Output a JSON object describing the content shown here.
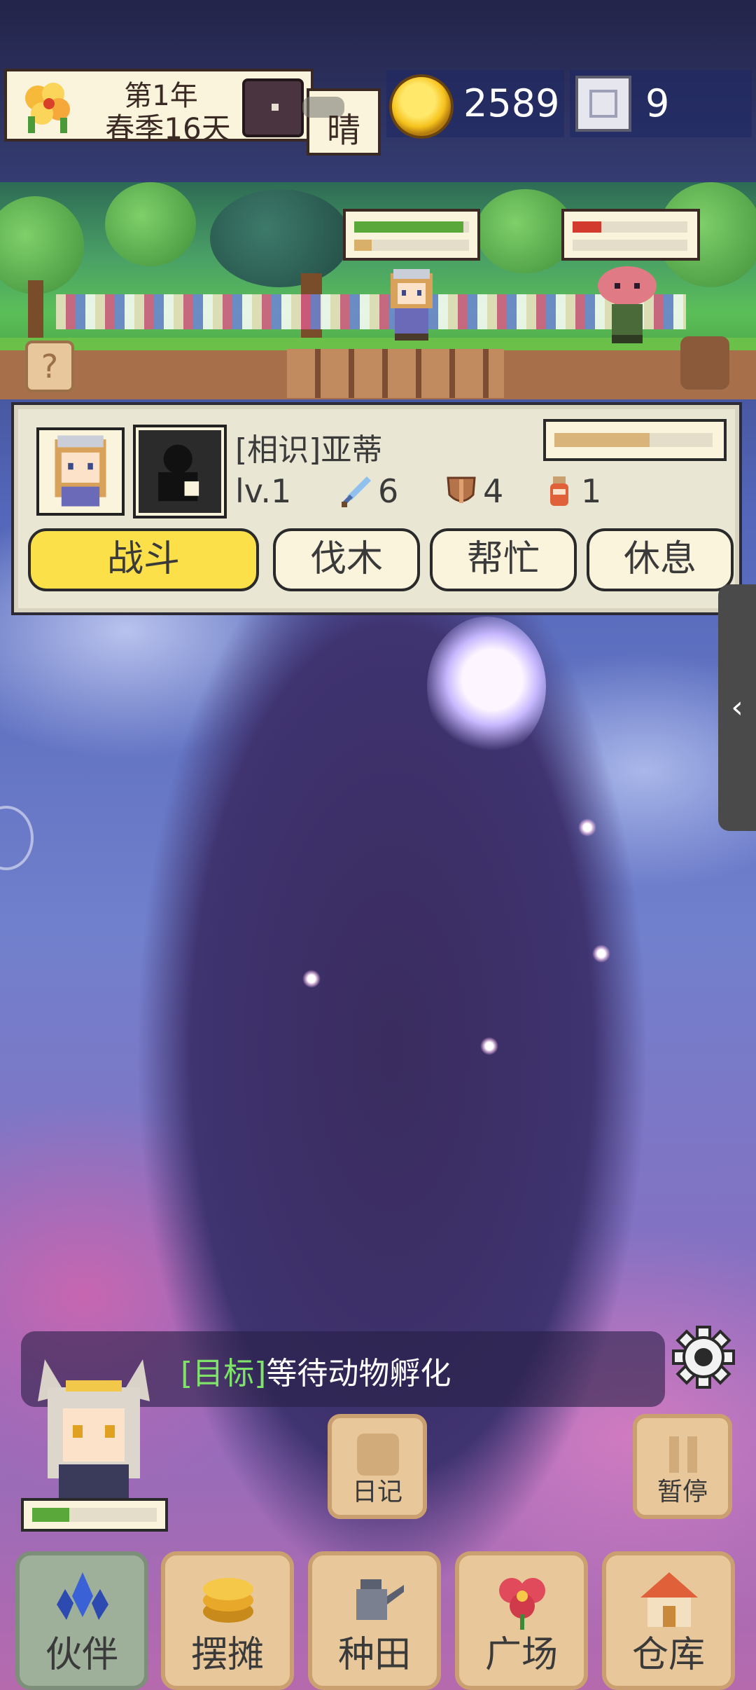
{
  "topbar": {
    "year": "第1年",
    "season_day": "春季16天",
    "weather": "晴",
    "coins": "2589",
    "gems": "9"
  },
  "companion": {
    "name": "[相识]亚蒂",
    "level": "lv.1",
    "attack": "6",
    "defense": "4",
    "potion": "1",
    "hp_fraction": 0.6,
    "tabs": [
      "战斗",
      "伐木",
      "帮忙",
      "休息"
    ],
    "active_tab": "战斗"
  },
  "scene": {
    "hero_hp_fraction": 0.95,
    "hero_sub_fraction": 0.15,
    "enemy_hp_fraction": 0.25
  },
  "goal": {
    "tag": "[目标]",
    "text": "等待动物孵化"
  },
  "buttons": {
    "diary": "日记",
    "pause": "暂停"
  },
  "nav": [
    {
      "label": "伙伴"
    },
    {
      "label": "摆摊"
    },
    {
      "label": "种田"
    },
    {
      "label": "广场"
    },
    {
      "label": "仓库"
    }
  ],
  "player_hp_fraction": 0.3,
  "colors": {
    "accent_yellow": "#fbe04a",
    "panel_cream": "#fbf4dd",
    "goal_green": "#7fe36a",
    "hp_green": "#5aa83a",
    "hp_red": "#d23a2e"
  }
}
